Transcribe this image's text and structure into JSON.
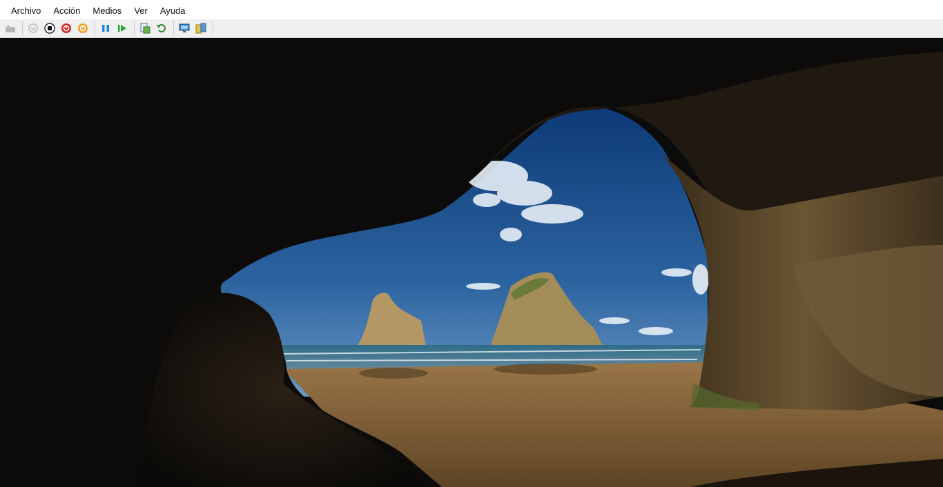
{
  "menu": {
    "items": [
      {
        "label": "Archivo"
      },
      {
        "label": "Acción"
      },
      {
        "label": "Medios"
      },
      {
        "label": "Ver"
      },
      {
        "label": "Ayuda"
      }
    ]
  },
  "toolbar": {
    "buttons": [
      {
        "name": "ctrl-alt-del-icon"
      },
      {
        "name": "start-icon"
      },
      {
        "name": "turn-off-icon"
      },
      {
        "name": "shut-down-icon"
      },
      {
        "name": "save-icon"
      },
      {
        "name": "pause-icon"
      },
      {
        "name": "reset-icon"
      },
      {
        "name": "checkpoint-icon"
      },
      {
        "name": "revert-icon"
      },
      {
        "name": "enhanced-session-icon"
      },
      {
        "name": "share-icon"
      }
    ]
  },
  "colors": {
    "menubar_bg": "#ffffff",
    "toolbar_bg": "#f0f0f0",
    "sky_top": "#0f3f7c",
    "sky_bottom": "#5a8bbd",
    "sand": "#8a6a3e",
    "rock_dark": "#0e0d0b"
  }
}
